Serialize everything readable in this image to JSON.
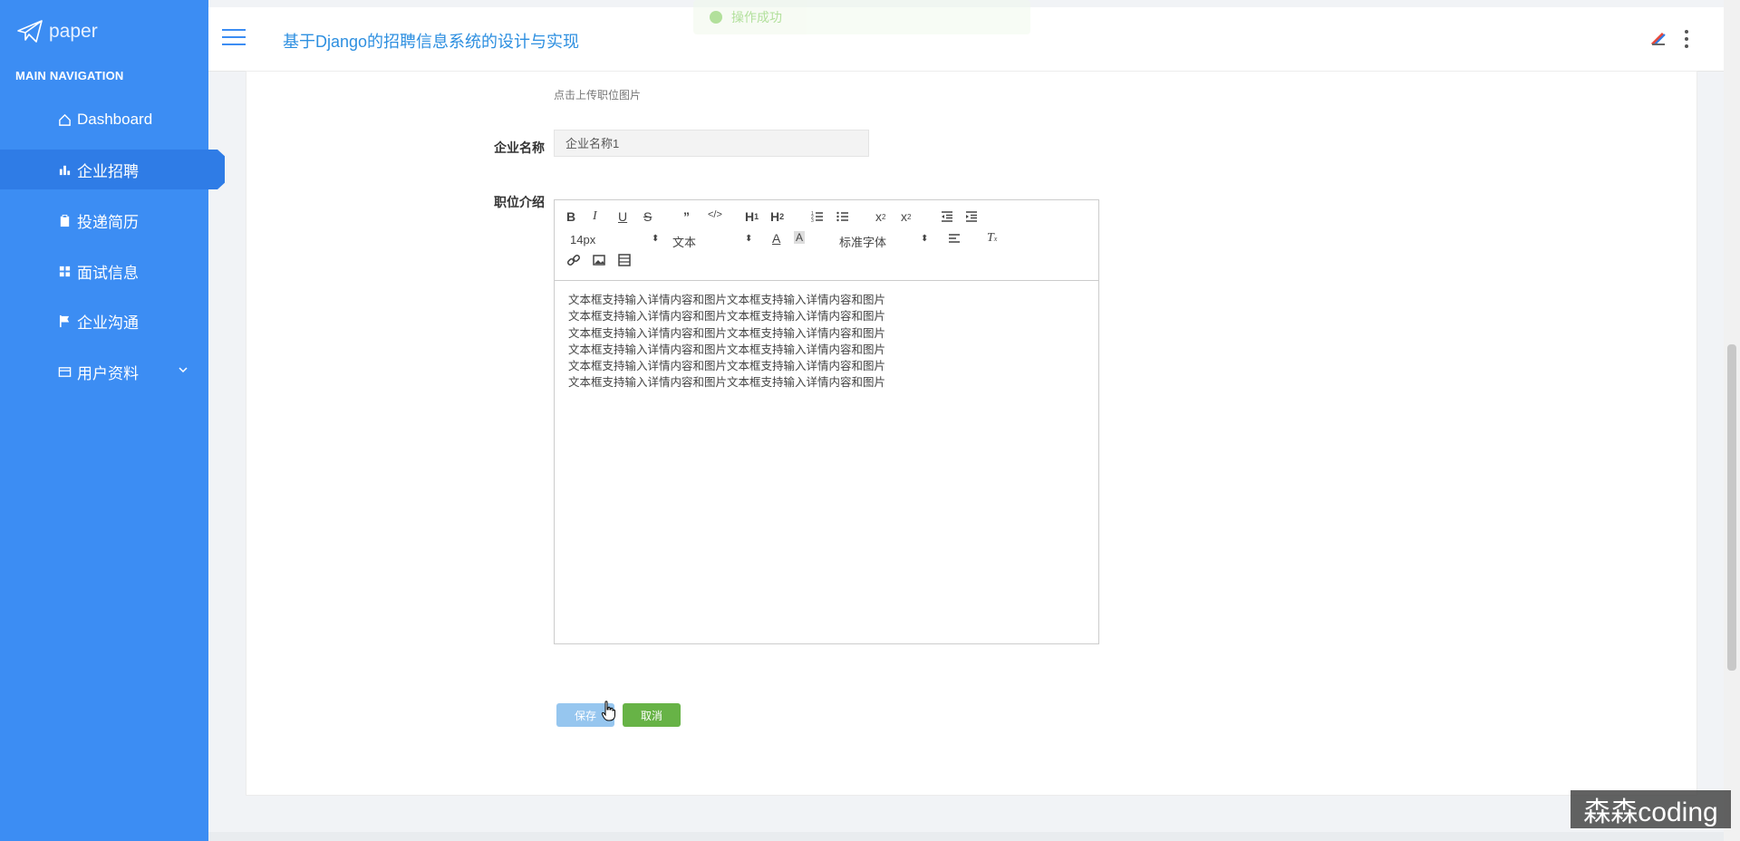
{
  "sidebar": {
    "logo_text": "paper",
    "nav_title": "MAIN NAVIGATION",
    "items": [
      {
        "label": "Dashboard",
        "icon": "home-icon"
      },
      {
        "label": "企业招聘",
        "icon": "bar-chart-icon"
      },
      {
        "label": "投递简历",
        "icon": "clipboard-icon"
      },
      {
        "label": "面试信息",
        "icon": "grid-icon"
      },
      {
        "label": "企业沟通",
        "icon": "flag-icon"
      },
      {
        "label": "用户资料",
        "icon": "card-icon"
      }
    ],
    "active_item": "企业招聘"
  },
  "header": {
    "title": "基于Django的招聘信息系统的设计与实现",
    "toast": "操作成功"
  },
  "form": {
    "image_hint": "点击上传职位图片",
    "company_label": "企业名称",
    "company_value": "企业名称1",
    "intro_label": "职位介绍"
  },
  "editor": {
    "font_size": "14px",
    "header_select": "文本",
    "font_family": "标准字体",
    "content_lines": [
      "文本框支持输入详情内容和图片文本框支持输入详情内容和图片",
      "文本框支持输入详情内容和图片文本框支持输入详情内容和图片",
      "文本框支持输入详情内容和图片文本框支持输入详情内容和图片",
      "文本框支持输入详情内容和图片文本框支持输入详情内容和图片",
      "文本框支持输入详情内容和图片文本框支持输入详情内容和图片",
      "文本框支持输入详情内容和图片文本框支持输入详情内容和图片"
    ]
  },
  "buttons": {
    "save": "保存",
    "cancel": "取消"
  },
  "watermark": "森森coding",
  "colors": {
    "sidebar": "#3c8df3",
    "active": "#2f7ce6",
    "title": "#2d8fe0",
    "save": "#96c6ef",
    "cancel": "#67b346"
  }
}
